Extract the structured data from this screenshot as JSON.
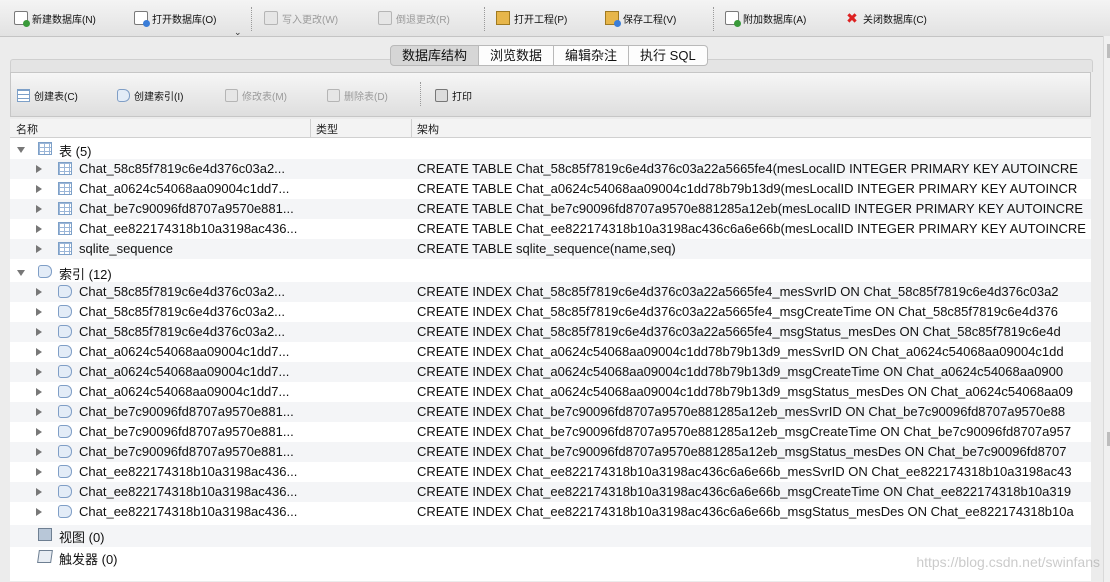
{
  "toolbar": {
    "new_db": "新建数据库(N)",
    "open_db": "打开数据库(O)",
    "write_changes": "写入更改(W)",
    "revert_changes": "倒退更改(R)",
    "open_project": "打开工程(P)",
    "save_project": "保存工程(V)",
    "attach_db": "附加数据库(A)",
    "close_db": "关闭数据库(C)"
  },
  "tabs": [
    "数据库结构",
    "浏览数据",
    "编辑杂注",
    "执行 SQL"
  ],
  "active_tab": 0,
  "subtoolbar": {
    "create_table": "创建表(C)",
    "create_index": "创建索引(I)",
    "modify_table": "修改表(M)",
    "delete_table": "删除表(D)",
    "print": "打印"
  },
  "columns": {
    "name": "名称",
    "type": "类型",
    "schema": "架构"
  },
  "groups": {
    "tables": "表 (5)",
    "indexes": "索引 (12)",
    "views": "视图 (0)",
    "triggers": "触发器 (0)"
  },
  "tables": [
    {
      "name": "Chat_58c85f7819c6e4d376c03a2...",
      "schema": "CREATE TABLE Chat_58c85f7819c6e4d376c03a22a5665fe4(mesLocalID INTEGER PRIMARY KEY AUTOINCRE"
    },
    {
      "name": "Chat_a0624c54068aa09004c1dd7...",
      "schema": "CREATE TABLE Chat_a0624c54068aa09004c1dd78b79b13d9(mesLocalID INTEGER PRIMARY KEY AUTOINCR"
    },
    {
      "name": "Chat_be7c90096fd8707a9570e881...",
      "schema": "CREATE TABLE Chat_be7c90096fd8707a9570e881285a12eb(mesLocalID INTEGER PRIMARY KEY AUTOINCRE"
    },
    {
      "name": "Chat_ee822174318b10a3198ac436...",
      "schema": "CREATE TABLE Chat_ee822174318b10a3198ac436c6a6e66b(mesLocalID INTEGER PRIMARY KEY AUTOINCRE"
    },
    {
      "name": "sqlite_sequence",
      "schema": "CREATE TABLE sqlite_sequence(name,seq)"
    }
  ],
  "indexes": [
    {
      "name": "Chat_58c85f7819c6e4d376c03a2...",
      "schema": "CREATE INDEX Chat_58c85f7819c6e4d376c03a22a5665fe4_mesSvrID ON Chat_58c85f7819c6e4d376c03a2"
    },
    {
      "name": "Chat_58c85f7819c6e4d376c03a2...",
      "schema": "CREATE INDEX Chat_58c85f7819c6e4d376c03a22a5665fe4_msgCreateTime ON Chat_58c85f7819c6e4d376"
    },
    {
      "name": "Chat_58c85f7819c6e4d376c03a2...",
      "schema": "CREATE INDEX Chat_58c85f7819c6e4d376c03a22a5665fe4_msgStatus_mesDes ON Chat_58c85f7819c6e4d"
    },
    {
      "name": "Chat_a0624c54068aa09004c1dd7...",
      "schema": "CREATE INDEX Chat_a0624c54068aa09004c1dd78b79b13d9_mesSvrID ON Chat_a0624c54068aa09004c1dd"
    },
    {
      "name": "Chat_a0624c54068aa09004c1dd7...",
      "schema": "CREATE INDEX Chat_a0624c54068aa09004c1dd78b79b13d9_msgCreateTime ON Chat_a0624c54068aa0900"
    },
    {
      "name": "Chat_a0624c54068aa09004c1dd7...",
      "schema": "CREATE INDEX Chat_a0624c54068aa09004c1dd78b79b13d9_msgStatus_mesDes ON Chat_a0624c54068aa09"
    },
    {
      "name": "Chat_be7c90096fd8707a9570e881...",
      "schema": "CREATE INDEX Chat_be7c90096fd8707a9570e881285a12eb_mesSvrID ON Chat_be7c90096fd8707a9570e88"
    },
    {
      "name": "Chat_be7c90096fd8707a9570e881...",
      "schema": "CREATE INDEX Chat_be7c90096fd8707a9570e881285a12eb_msgCreateTime ON Chat_be7c90096fd8707a957"
    },
    {
      "name": "Chat_be7c90096fd8707a9570e881...",
      "schema": "CREATE INDEX Chat_be7c90096fd8707a9570e881285a12eb_msgStatus_mesDes ON Chat_be7c90096fd8707"
    },
    {
      "name": "Chat_ee822174318b10a3198ac436...",
      "schema": "CREATE INDEX Chat_ee822174318b10a3198ac436c6a6e66b_mesSvrID ON Chat_ee822174318b10a3198ac43"
    },
    {
      "name": "Chat_ee822174318b10a3198ac436...",
      "schema": "CREATE INDEX Chat_ee822174318b10a3198ac436c6a6e66b_msgCreateTime ON Chat_ee822174318b10a319"
    },
    {
      "name": "Chat_ee822174318b10a3198ac436...",
      "schema": "CREATE INDEX Chat_ee822174318b10a3198ac436c6a6e66b_msgStatus_mesDes ON Chat_ee822174318b10a"
    }
  ],
  "watermark": "https://blog.csdn.net/swinfans"
}
